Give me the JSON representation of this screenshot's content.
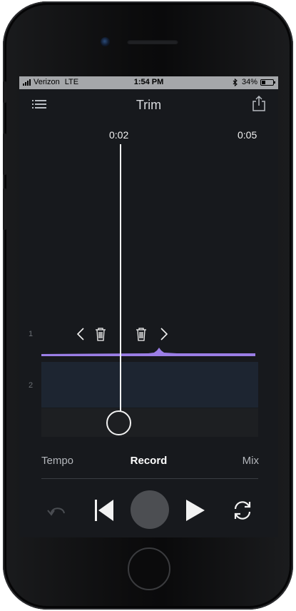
{
  "status_bar": {
    "carrier": "Verizon",
    "network": "LTE",
    "time": "1:54 PM",
    "bluetooth": "bluetooth-icon",
    "battery_percent": "34%",
    "battery_level": 0.34
  },
  "header": {
    "title": "Trim",
    "menu_icon": "hamburger-menu-icon",
    "share_icon": "share-icon"
  },
  "timeline": {
    "playhead_time": "0:02",
    "end_time": "0:05"
  },
  "tracks": [
    {
      "number": "1"
    },
    {
      "number": "2"
    }
  ],
  "tabs": {
    "left": "Tempo",
    "center": "Record",
    "right": "Mix"
  },
  "colors": {
    "background": "#17191d",
    "waveform": "#9b7ee6",
    "track2": "#1d2531",
    "accent_white": "#f2f2f2"
  }
}
